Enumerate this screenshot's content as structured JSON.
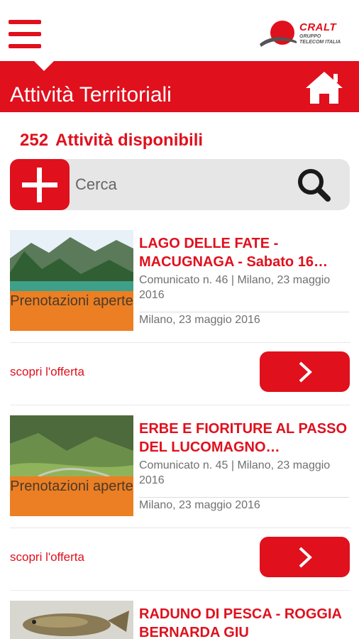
{
  "header": {
    "logo_text": "CRALT",
    "logo_sub_1": "GRUPPO",
    "logo_sub_2": "TELECOM ITALIA",
    "title": "Attività Territoriali"
  },
  "summary": {
    "count": "252",
    "label": "Attività disponibili"
  },
  "search": {
    "placeholder": "Cerca"
  },
  "activities": [
    {
      "title": "LAGO DELLE FATE - MACUGNAGA - Sabato 16…",
      "description": "Comunicato n. 46 | Milano, 23 maggio 2016",
      "date": "Milano, 23 maggio 2016",
      "badge": "Prenotazioni aperte",
      "link": "scopri l'offerta"
    },
    {
      "title": "ERBE E FIORITURE AL PASSO DEL LUCOMAGNO…",
      "description": "Comunicato n. 45 | Milano, 23 maggio 2016",
      "date": "Milano, 23 maggio 2016",
      "badge": "Prenotazioni aperte",
      "link": "scopri l'offerta"
    },
    {
      "title": "RADUNO DI PESCA - ROGGIA BERNARDA GIU"
    }
  ],
  "colors": {
    "brand_red": "#e0101d",
    "badge_orange": "#ec7f23"
  }
}
